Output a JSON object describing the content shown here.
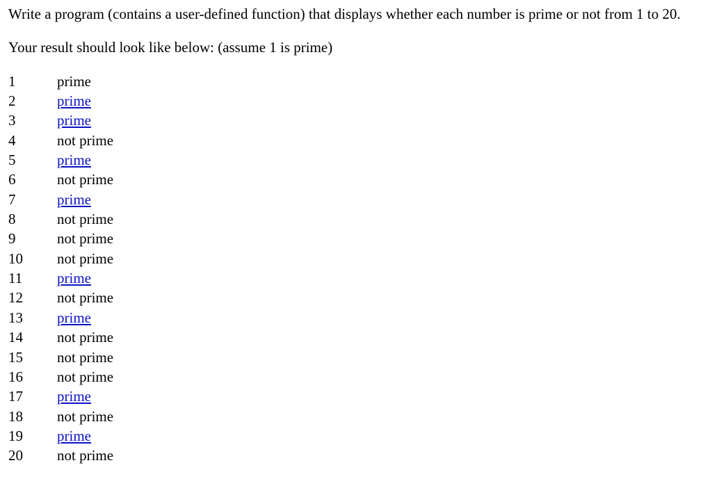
{
  "prompt": {
    "paragraph1": "Write a program (contains a user-defined function) that displays whether each number is prime or not from 1 to 20.",
    "paragraph2": "Your result should look like below: (assume 1 is prime)"
  },
  "labels": {
    "prime": "prime",
    "not_prime": "not prime"
  },
  "results": [
    {
      "n": "1",
      "status": "prime",
      "linkStyle": false
    },
    {
      "n": "2",
      "status": "prime",
      "linkStyle": true
    },
    {
      "n": "3",
      "status": "prime",
      "linkStyle": true
    },
    {
      "n": "4",
      "status": "not_prime",
      "linkStyle": false
    },
    {
      "n": "5",
      "status": "prime",
      "linkStyle": true
    },
    {
      "n": "6",
      "status": "not_prime",
      "linkStyle": false
    },
    {
      "n": "7",
      "status": "prime",
      "linkStyle": true
    },
    {
      "n": "8",
      "status": "not_prime",
      "linkStyle": false
    },
    {
      "n": "9",
      "status": "not_prime",
      "linkStyle": false
    },
    {
      "n": "10",
      "status": "not_prime",
      "linkStyle": false
    },
    {
      "n": "11",
      "status": "prime",
      "linkStyle": true
    },
    {
      "n": "12",
      "status": "not_prime",
      "linkStyle": false
    },
    {
      "n": "13",
      "status": "prime",
      "linkStyle": true
    },
    {
      "n": "14",
      "status": "not_prime",
      "linkStyle": false
    },
    {
      "n": "15",
      "status": "not_prime",
      "linkStyle": false
    },
    {
      "n": "16",
      "status": "not_prime",
      "linkStyle": false
    },
    {
      "n": "17",
      "status": "prime",
      "linkStyle": true
    },
    {
      "n": "18",
      "status": "not_prime",
      "linkStyle": false
    },
    {
      "n": "19",
      "status": "prime",
      "linkStyle": true
    },
    {
      "n": "20",
      "status": "not_prime",
      "linkStyle": false
    }
  ]
}
